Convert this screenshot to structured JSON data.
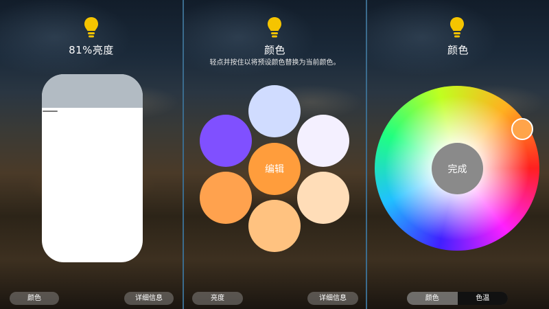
{
  "colors": {
    "bulb": "#f5c400",
    "slider_fill": "#ffffff",
    "swatches": [
      "#d0dcff",
      "#8050ff",
      "#f4f0ff",
      "#ff9d3c",
      "#ffa24e",
      "#ffddb8",
      "#ffc280"
    ],
    "wheel_handle": "#ffa44a"
  },
  "brightness_panel": {
    "icon": "lightbulb-icon",
    "title": "81%亮度",
    "brightness_fraction": 0.81,
    "left_button": "颜色",
    "right_button": "详细信息"
  },
  "color_panel": {
    "icon": "lightbulb-icon",
    "title": "颜色",
    "subtitle": "轻点并按住以将预设颜色替换为当前颜色。",
    "edit_label": "编辑",
    "left_button": "亮度",
    "right_button": "详细信息"
  },
  "wheel_panel": {
    "icon": "lightbulb-icon",
    "title": "颜色",
    "done_label": "完成",
    "segments": [
      "颜色",
      "色温"
    ],
    "selected_segment": "色温"
  }
}
